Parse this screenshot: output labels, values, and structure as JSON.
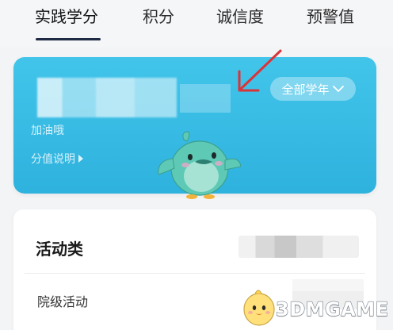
{
  "tabs": [
    {
      "label": "实践学分",
      "active": true
    },
    {
      "label": "积分",
      "active": false
    },
    {
      "label": "诚信度",
      "active": false
    },
    {
      "label": "预警值",
      "active": false
    }
  ],
  "score_card": {
    "year_filter": "全部学年",
    "cheer_text": "加油哦",
    "explain_link": "分值说明"
  },
  "activity_section": {
    "title": "活动类",
    "rows": [
      {
        "label": "院级活动"
      }
    ]
  },
  "watermark": {
    "text": "3DMGAME"
  },
  "colors": {
    "accent_blue": "#35bbe4",
    "tab_underline": "#1f2a44",
    "annotation_red": "#d9343a"
  }
}
